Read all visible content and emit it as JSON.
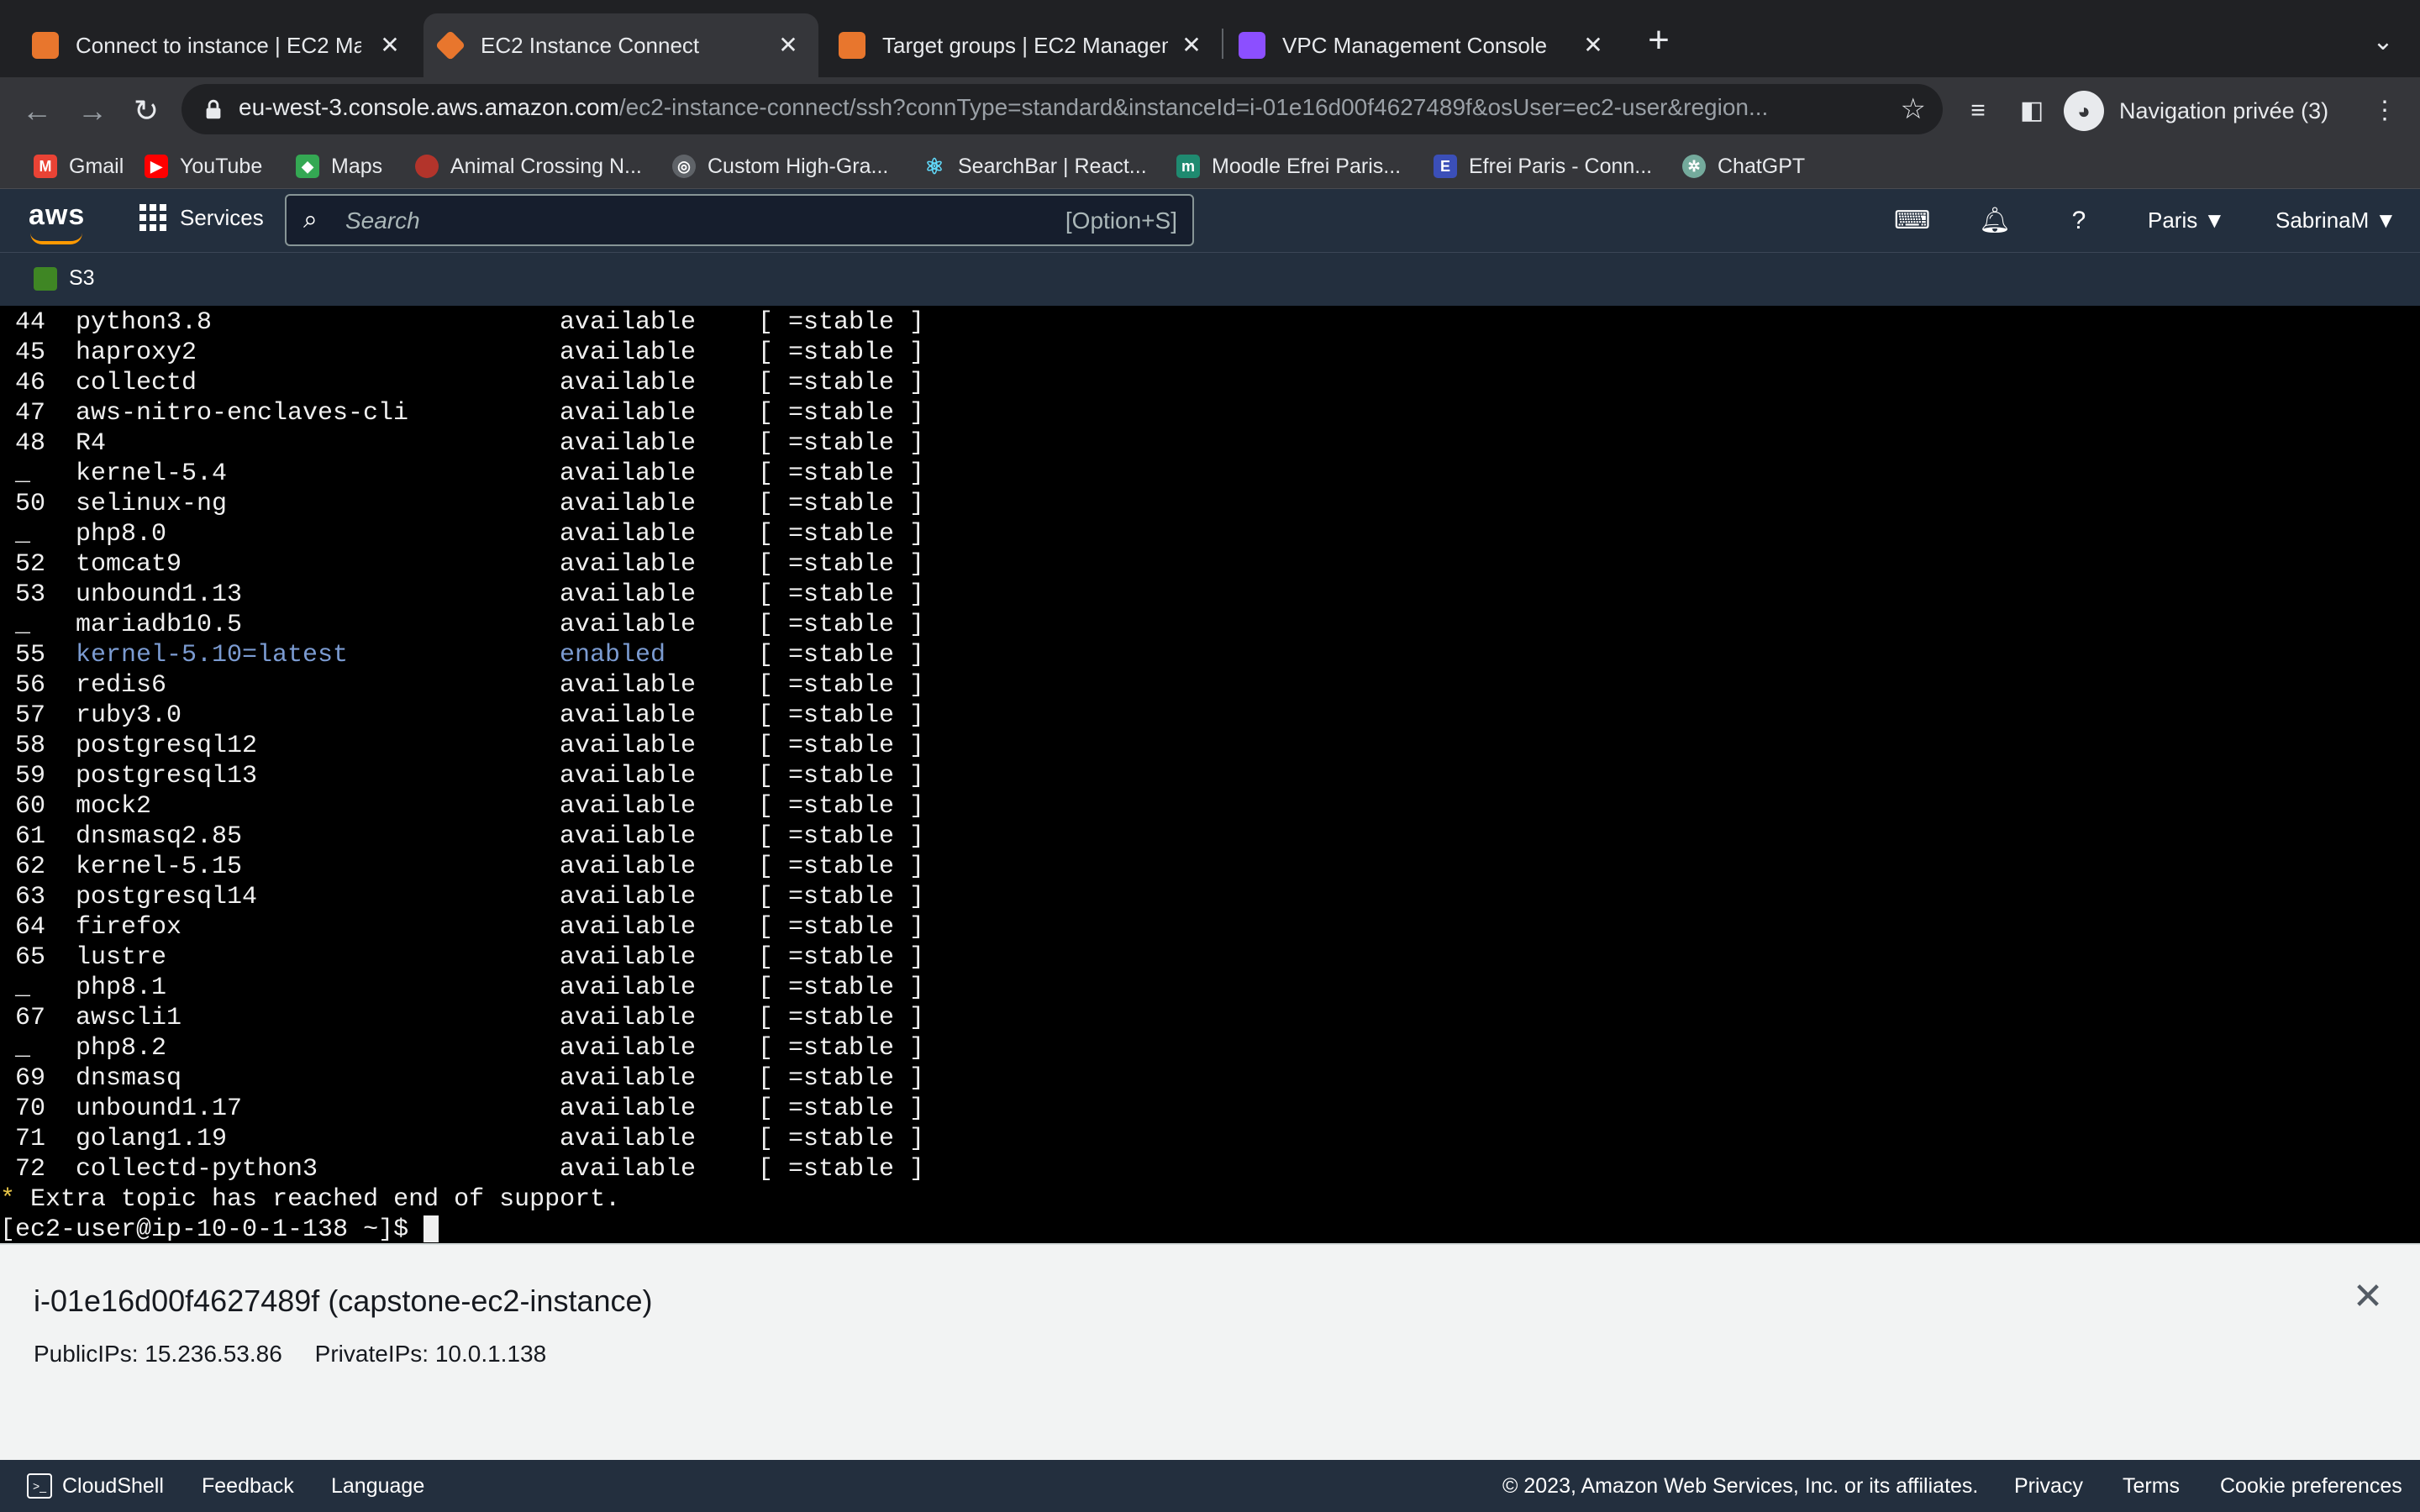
{
  "browser": {
    "tabs": [
      {
        "title": "Connect to instance | EC2 Man",
        "favicon": "aws-ec2-icon",
        "color": "#e8762d"
      },
      {
        "title": "EC2 Instance Connect",
        "favicon": "aws-instance-icon",
        "color": "#e8762d"
      },
      {
        "title": "Target groups | EC2 Manageme",
        "favicon": "aws-ec2-icon",
        "color": "#e8762d"
      },
      {
        "title": "VPC Management Console",
        "favicon": "aws-vpc-icon",
        "color": "#8c4fff"
      }
    ],
    "url_host": "eu-west-3.console.aws.amazon.com",
    "url_path": "/ec2-instance-connect/ssh?connType=standard&instanceId=i-01e16d00f4627489f&osUser=ec2-user&region...",
    "incognito_label": "Navigation privée (3)",
    "bookmarks": [
      {
        "label": "Gmail",
        "icon": "gmail-icon"
      },
      {
        "label": "YouTube",
        "icon": "youtube-icon"
      },
      {
        "label": "Maps",
        "icon": "maps-icon"
      },
      {
        "label": "Animal Crossing N...",
        "icon": "animal-crossing-icon"
      },
      {
        "label": "Custom High-Gra...",
        "icon": "globe-icon"
      },
      {
        "label": "SearchBar | React...",
        "icon": "react-icon"
      },
      {
        "label": "Moodle Efrei Paris...",
        "icon": "moodle-icon"
      },
      {
        "label": "Efrei Paris - Conn...",
        "icon": "efrei-icon"
      },
      {
        "label": "ChatGPT",
        "icon": "chatgpt-icon"
      }
    ]
  },
  "aws": {
    "logo": "aws",
    "services_label": "Services",
    "search_placeholder": "Search",
    "search_shortcut": "[Option+S]",
    "region": "Paris",
    "user": "SabrinaM",
    "favorite": "S3",
    "accent": "#ff9900"
  },
  "terminal": {
    "rows": [
      {
        "num": "44",
        "name": "python3.8",
        "state": "available",
        "channel": "[ =stable ]"
      },
      {
        "num": "45",
        "name": "haproxy2",
        "state": "available",
        "channel": "[ =stable ]"
      },
      {
        "num": "46",
        "name": "collectd",
        "state": "available",
        "channel": "[ =stable ]"
      },
      {
        "num": "47",
        "name": "aws-nitro-enclaves-cli",
        "state": "available",
        "channel": "[ =stable ]"
      },
      {
        "num": "48",
        "name": "R4",
        "state": "available",
        "channel": "[ =stable ]"
      },
      {
        "num": "_",
        "name": "kernel-5.4",
        "state": "available",
        "channel": "[ =stable ]"
      },
      {
        "num": "50",
        "name": "selinux-ng",
        "state": "available",
        "channel": "[ =stable ]"
      },
      {
        "num": "_",
        "name": "php8.0",
        "state": "available",
        "channel": "[ =stable ]"
      },
      {
        "num": "52",
        "name": "tomcat9",
        "state": "available",
        "channel": "[ =stable ]"
      },
      {
        "num": "53",
        "name": "unbound1.13",
        "state": "available",
        "channel": "[ =stable ]"
      },
      {
        "num": "_",
        "name": "mariadb10.5",
        "state": "available",
        "channel": "[ =stable ]"
      },
      {
        "num": "55",
        "name": "kernel-5.10=latest",
        "state": "enabled",
        "channel": "[ =stable ]",
        "highlight": true
      },
      {
        "num": "56",
        "name": "redis6",
        "state": "available",
        "channel": "[ =stable ]"
      },
      {
        "num": "57",
        "name": "ruby3.0",
        "state": "available",
        "channel": "[ =stable ]"
      },
      {
        "num": "58",
        "name": "postgresql12",
        "state": "available",
        "channel": "[ =stable ]"
      },
      {
        "num": "59",
        "name": "postgresql13",
        "state": "available",
        "channel": "[ =stable ]"
      },
      {
        "num": "60",
        "name": "mock2",
        "state": "available",
        "channel": "[ =stable ]"
      },
      {
        "num": "61",
        "name": "dnsmasq2.85",
        "state": "available",
        "channel": "[ =stable ]"
      },
      {
        "num": "62",
        "name": "kernel-5.15",
        "state": "available",
        "channel": "[ =stable ]"
      },
      {
        "num": "63",
        "name": "postgresql14",
        "state": "available",
        "channel": "[ =stable ]"
      },
      {
        "num": "64",
        "name": "firefox",
        "state": "available",
        "channel": "[ =stable ]"
      },
      {
        "num": "65",
        "name": "lustre",
        "state": "available",
        "channel": "[ =stable ]"
      },
      {
        "num": "_",
        "name": "php8.1",
        "state": "available",
        "channel": "[ =stable ]"
      },
      {
        "num": "67",
        "name": "awscli1",
        "state": "available",
        "channel": "[ =stable ]"
      },
      {
        "num": "_",
        "name": "php8.2",
        "state": "available",
        "channel": "[ =stable ]"
      },
      {
        "num": "69",
        "name": "dnsmasq",
        "state": "available",
        "channel": "[ =stable ]"
      },
      {
        "num": "70",
        "name": "unbound1.17",
        "state": "available",
        "channel": "[ =stable ]"
      },
      {
        "num": "71",
        "name": "golang1.19",
        "state": "available",
        "channel": "[ =stable ]"
      },
      {
        "num": "72",
        "name": "collectd-python3",
        "state": "available",
        "channel": "[ =stable ]"
      }
    ],
    "notice_star": "*",
    "notice": " Extra topic has reached end of support.",
    "prompt": "[ec2-user@ip-10-0-1-138 ~]$ "
  },
  "instance": {
    "title": "i-01e16d00f4627489f (capstone-ec2-instance)",
    "public_ips": "PublicIPs: 15.236.53.86",
    "private_ips": "PrivateIPs: 10.0.1.138"
  },
  "footer": {
    "cloudshell": "CloudShell",
    "feedback": "Feedback",
    "language": "Language",
    "copyright": "© 2023, Amazon Web Services, Inc. or its affiliates.",
    "privacy": "Privacy",
    "terms": "Terms",
    "cookies": "Cookie preferences"
  }
}
